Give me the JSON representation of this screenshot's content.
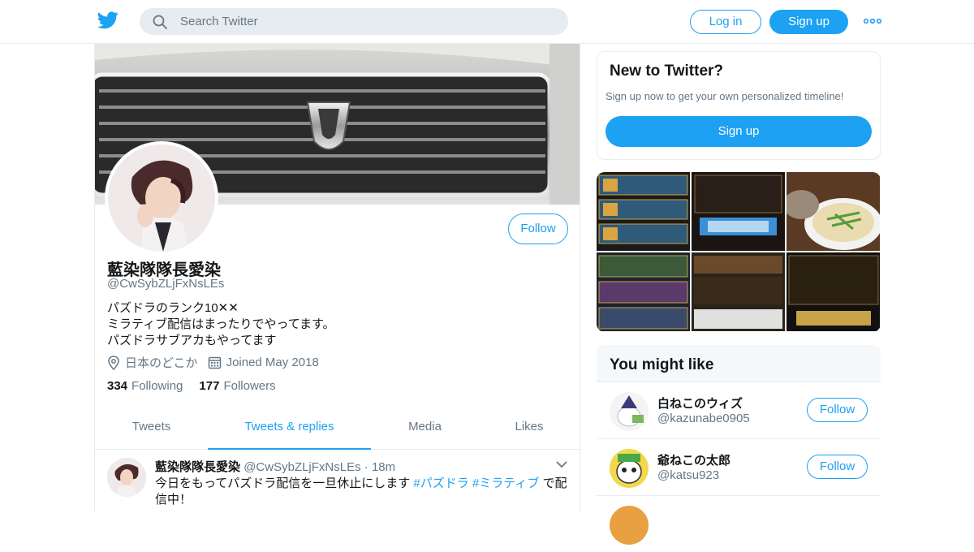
{
  "header": {
    "search_placeholder": "Search Twitter",
    "login_label": "Log in",
    "signup_label": "Sign up",
    "brand_color": "#1da1f2"
  },
  "profile": {
    "name": "藍染隊隊長愛染",
    "handle": "@CwSybZLjFxNsLEs",
    "follow_label": "Follow",
    "bio": [
      "パズドラのランク10✕✕",
      "ミラティブ配信はまったりでやってます。",
      "パズドラサブアカもやってます"
    ],
    "location": "日本のどこか",
    "joined": "Joined May 2018",
    "following_count": "334",
    "following_label": "Following",
    "followers_count": "177",
    "followers_label": "Followers"
  },
  "tabs": [
    {
      "label": "Tweets",
      "active": false
    },
    {
      "label": "Tweets & replies",
      "active": true
    },
    {
      "label": "Media",
      "active": false
    },
    {
      "label": "Likes",
      "active": false
    }
  ],
  "tweet": {
    "name": "藍染隊隊長愛染",
    "handle": "@CwSybZLjFxNsLEs",
    "separator": "·",
    "time": "18m",
    "text_before": "今日をもってパズドラ配信を一旦休止にします ",
    "hashtag1": "#パズドラ",
    "hashtag2": "#ミラティブ",
    "text_after": " で配信中！"
  },
  "signup_card": {
    "title": "New to Twitter?",
    "subtitle": "Sign up now to get your own personalized timeline!",
    "button": "Sign up"
  },
  "you_might_like": {
    "title": "You might like",
    "items": [
      {
        "name": "白ねこのウィズ",
        "handle": "@kazunabe0905",
        "follow": "Follow"
      },
      {
        "name": "爺ねこの太郎",
        "handle": "@katsu923",
        "follow": "Follow"
      }
    ]
  }
}
